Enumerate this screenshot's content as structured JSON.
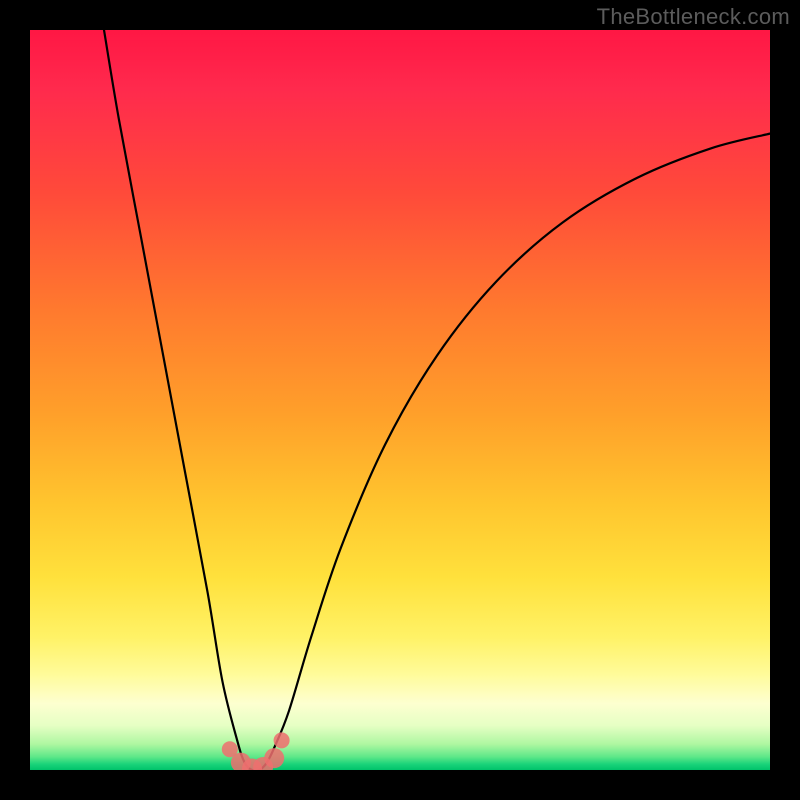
{
  "watermark": "TheBottleneck.com",
  "chart_data": {
    "type": "line",
    "title": "",
    "xlabel": "",
    "ylabel": "",
    "xlim": [
      0,
      100
    ],
    "ylim": [
      0,
      100
    ],
    "series": [
      {
        "name": "bottleneck-curve",
        "x": [
          10,
          12,
          15,
          18,
          21,
          24,
          26,
          28,
          29,
          30,
          31,
          32,
          33,
          35,
          38,
          42,
          48,
          55,
          63,
          72,
          82,
          92,
          100
        ],
        "y": [
          100,
          88,
          72,
          56,
          40,
          24,
          12,
          4,
          1,
          0,
          0,
          1,
          3,
          8,
          18,
          30,
          44,
          56,
          66,
          74,
          80,
          84,
          86
        ]
      }
    ],
    "markers": {
      "name": "highlight-points",
      "color": "#ef6f6f",
      "x": [
        27.0,
        28.5,
        30.0,
        31.5,
        33.0,
        34.0
      ],
      "y": [
        2.8,
        1.0,
        0.2,
        0.4,
        1.6,
        4.0
      ]
    },
    "gradient_stops": [
      {
        "pos": 0.0,
        "color": "#ff1744"
      },
      {
        "pos": 0.5,
        "color": "#ffa02a"
      },
      {
        "pos": 0.82,
        "color": "#fff266"
      },
      {
        "pos": 0.96,
        "color": "#aef7a1"
      },
      {
        "pos": 1.0,
        "color": "#00c36a"
      }
    ]
  }
}
